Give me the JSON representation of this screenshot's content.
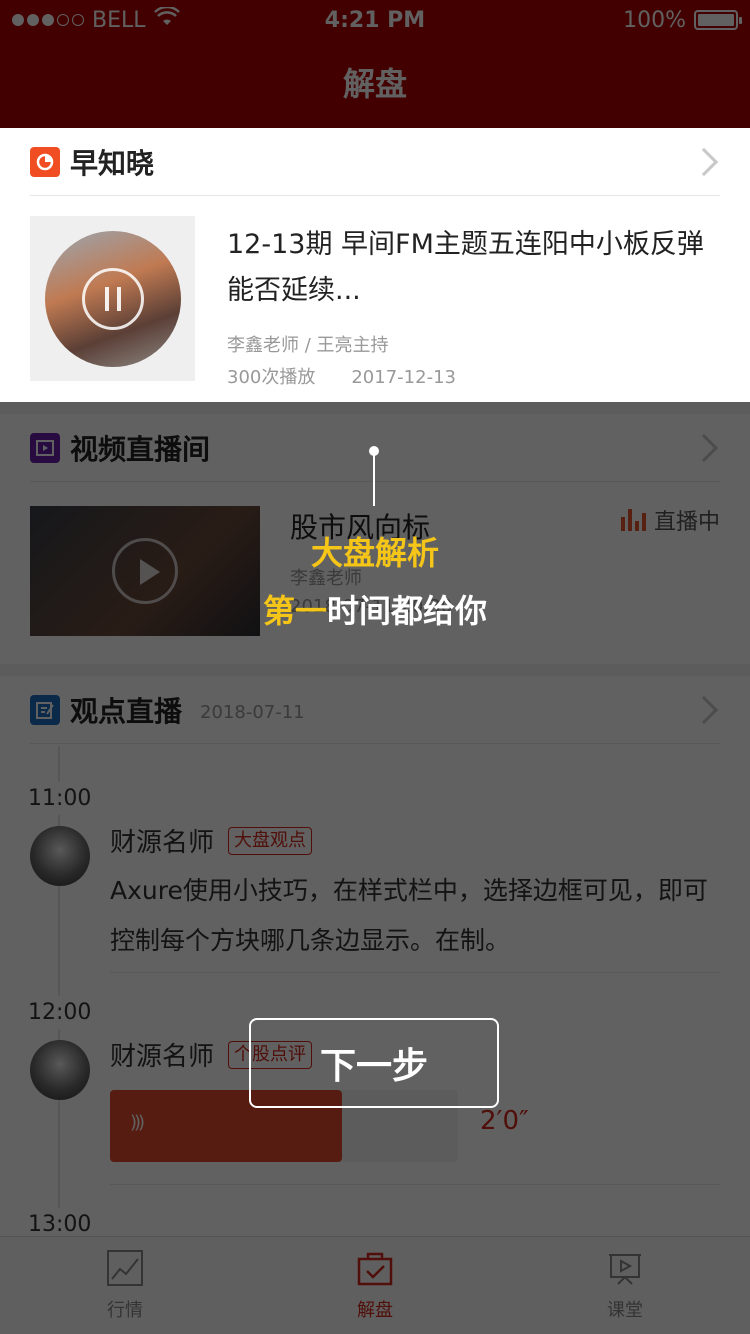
{
  "status": {
    "carrier": "BELL",
    "time": "4:21 PM",
    "battery": "100%"
  },
  "nav": {
    "title": "解盘"
  },
  "fm": {
    "section_title": "早知晓",
    "title": "12-13期 早间FM主题五连阳中小板反弹能否延续...",
    "hosts": "李鑫老师 / 王亮主持",
    "plays": "300次播放",
    "date": "2017-12-13"
  },
  "video": {
    "section_title": "视频直播间",
    "title": "股市风向标",
    "host": "李鑫老师",
    "time": "2018-07-11 20:30",
    "live_label": "直播中"
  },
  "view": {
    "section_title": "观点直播",
    "date": "2018-07-11",
    "posts": [
      {
        "time": "11:00",
        "author": "财源名师",
        "tag": "大盘观点",
        "text": "Axure使用小技巧，在样式栏中，选择边框可见，即可控制每个方块哪几条边显示。在制。"
      },
      {
        "time": "12:00",
        "author": "财源名师",
        "tag": "个股点评",
        "audio_length": "2′0″"
      },
      {
        "time": "13:00"
      }
    ]
  },
  "tabs": [
    {
      "label": "行情",
      "icon": "chart-icon",
      "active": false
    },
    {
      "label": "解盘",
      "icon": "briefcase-check-icon",
      "active": true
    },
    {
      "label": "课堂",
      "icon": "presentation-icon",
      "active": false
    }
  ],
  "guide": {
    "line1": "大盘解析",
    "line2_highlight": "第一",
    "line2_rest": "时间都给你",
    "next_button": "下一步"
  },
  "colors": {
    "brand": "#b10000",
    "accent": "#d2281c",
    "highlight": "#f5c518"
  }
}
